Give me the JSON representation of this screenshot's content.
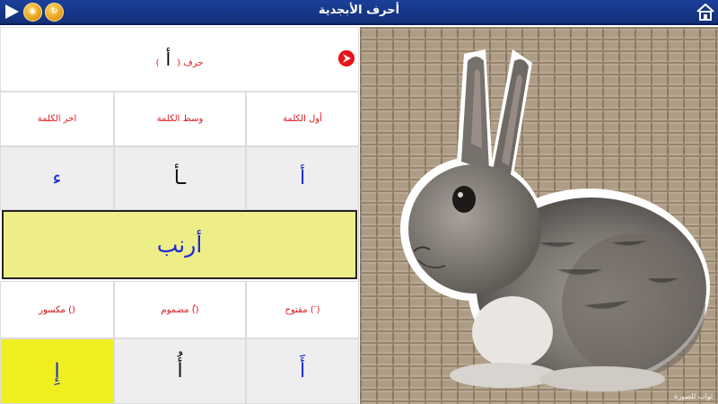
{
  "titlebar": {
    "title": "أحرف الأبجدية"
  },
  "header": {
    "label_pre": "حرف (",
    "letter": "أ",
    "label_post": ")"
  },
  "positions": {
    "first_label": "أول الكلمة",
    "middle_label": "وسط الكلمة",
    "last_label": "اخر الكلمة",
    "first_letter": "أ",
    "middle_letter": "ـأ",
    "last_letter": "ء"
  },
  "word": "أرنب",
  "vowels": {
    "fatha_label": "مفتوح ( َ)",
    "damma_label": "مضموم (ُ)",
    "kasra_label": "مكسور (ِ)",
    "fatha_letter": "أَ",
    "damma_letter": "أُ",
    "kasra_letter": "إِ"
  },
  "picture": {
    "watermark": "ثواب للصورة"
  },
  "colors": {
    "titlebar": "#1b3f9a",
    "label_red": "#e0181e",
    "letter_blue": "#1828d8",
    "word_box": "#eeee88",
    "selected_cell": "#f0f020",
    "neutral_cell": "#eeeeee"
  }
}
